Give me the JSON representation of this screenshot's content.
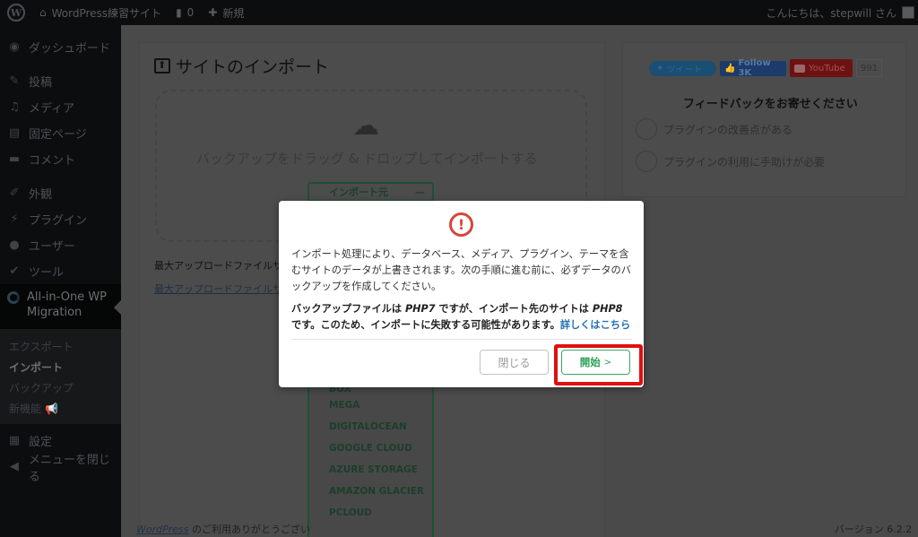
{
  "adminbar": {
    "wp_logo": "wordpress-logo",
    "site_name": "WordPress練習サイト",
    "comments_count": "0",
    "new_label": "新規",
    "greeting": "こんにちは、stepwill さん"
  },
  "sidebar": {
    "items": [
      {
        "label": "ダッシュボード",
        "icon": "dashboard-icon"
      },
      {
        "label": "投稿",
        "icon": "pin-icon"
      },
      {
        "label": "メディア",
        "icon": "media-icon"
      },
      {
        "label": "固定ページ",
        "icon": "pages-icon"
      },
      {
        "label": "コメント",
        "icon": "comment-icon"
      },
      {
        "label": "外観",
        "icon": "brush-icon"
      },
      {
        "label": "プラグイン",
        "icon": "plugin-icon"
      },
      {
        "label": "ユーザー",
        "icon": "user-icon"
      },
      {
        "label": "ツール",
        "icon": "wrench-icon"
      }
    ],
    "current": {
      "label_line1": "All-in-One WP",
      "label_line2": "Migration"
    },
    "submenu": [
      {
        "label": "エクスポート"
      },
      {
        "label": "インポート",
        "active": true
      },
      {
        "label": "バックアップ"
      },
      {
        "label": "新機能",
        "icon": "megaphone-icon"
      }
    ],
    "settings_label": "設定",
    "collapse_label": "メニューを閉じる"
  },
  "main": {
    "title": "サイトのインポート",
    "drop_text": "バックアップをドラッグ & ドロップしてインポートする",
    "import_from_label": "インポート元",
    "import_from_toggle": "—",
    "max_upload_text": "最大アップロードファイルサ",
    "max_upload_link": "最大アップロードファイルサ",
    "import_sources": [
      "BOX",
      "MEGA",
      "DIGITALOCEAN",
      "GOOGLE CLOUD",
      "AZURE STORAGE",
      "AMAZON GLACIER",
      "PCLOUD"
    ]
  },
  "right_panel": {
    "tweet_label": "ツイート",
    "facebook_label": "Follow 3K",
    "youtube_label": "YouTube",
    "youtube_count": "991",
    "feedback_title": "フィードバックをお寄せください",
    "feedback_options": [
      "プラグインの改善点がある",
      "プラグインの利用に手助けが必要"
    ]
  },
  "footer": {
    "wp_link": "WordPress",
    "thanks": " のご利用ありがとうござい",
    "version": "バージョン 6.2.2"
  },
  "modal": {
    "message": "インポート処理により、データベース、メディア、プラグイン、テーマを含むサイトのデータが上書きされます。次の手順に進む前に、必ずデータのバックアップを作成してください。",
    "warn_part1": "バックアップファイルは ",
    "backup_php": "PHP7",
    "warn_part2": " ですが、インポート先のサイトは ",
    "target_php": "PHP8",
    "warn_part3": " です。このため、インポートに失敗する可能性があります。",
    "more_link": "詳しくはこちら",
    "close_label": "閉じる",
    "start_label": "開始",
    "start_chevron": ">"
  },
  "colors": {
    "highlight": "#e01010",
    "start_green": "#2ea05a",
    "warning_red": "#d6453d",
    "link_blue": "#2271b1"
  }
}
